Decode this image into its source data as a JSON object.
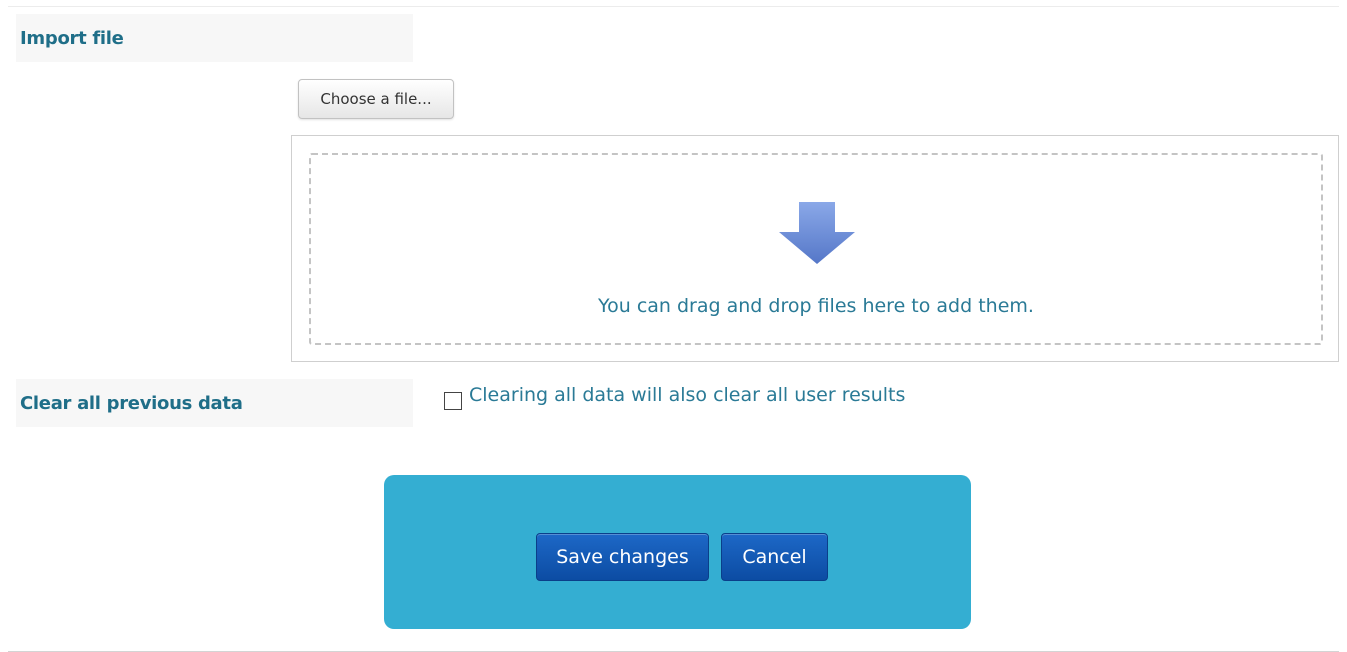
{
  "import_file": {
    "label": "Import file",
    "choose_button_label": "Choose a file...",
    "dropzone_text": "You can drag and drop files here to add them.",
    "arrow_icon": "arrow-down-icon",
    "arrow_color": "#6b8fd6"
  },
  "clear_data": {
    "label": "Clear all previous data",
    "checkbox_label": "Clearing all data will also clear all user results",
    "checked": false
  },
  "actions": {
    "save_label": "Save changes",
    "cancel_label": "Cancel",
    "panel_color": "#34aed2",
    "button_color": "#0c4ca3"
  },
  "colors": {
    "label_text": "#1f6e88",
    "body_text": "#2a7a96"
  }
}
